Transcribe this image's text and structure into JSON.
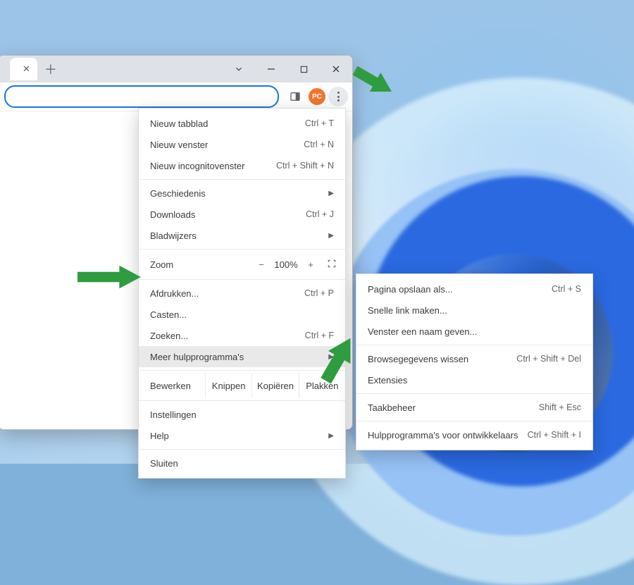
{
  "avatar_initials": "PC",
  "zoom": {
    "label": "Zoom",
    "minus": "−",
    "plus": "+",
    "percent": "100%"
  },
  "main_menu": {
    "new_tab": {
      "label": "Nieuw tabblad",
      "shortcut": "Ctrl + T"
    },
    "new_window": {
      "label": "Nieuw venster",
      "shortcut": "Ctrl + N"
    },
    "new_incognito": {
      "label": "Nieuw incognitovenster",
      "shortcut": "Ctrl + Shift + N"
    },
    "history": {
      "label": "Geschiedenis"
    },
    "downloads": {
      "label": "Downloads",
      "shortcut": "Ctrl + J"
    },
    "bookmarks": {
      "label": "Bladwijzers"
    },
    "print": {
      "label": "Afdrukken...",
      "shortcut": "Ctrl + P"
    },
    "cast": {
      "label": "Casten..."
    },
    "find": {
      "label": "Zoeken...",
      "shortcut": "Ctrl + F"
    },
    "more_tools": {
      "label": "Meer hulpprogramma's"
    },
    "edit": {
      "label": "Bewerken",
      "cut": "Knippen",
      "copy": "Kopiëren",
      "paste": "Plakken"
    },
    "settings": {
      "label": "Instellingen"
    },
    "help": {
      "label": "Help"
    },
    "exit": {
      "label": "Sluiten"
    }
  },
  "sub_menu": {
    "save_page": {
      "label": "Pagina opslaan als...",
      "shortcut": "Ctrl + S"
    },
    "create_shortcut": {
      "label": "Snelle link maken..."
    },
    "name_window": {
      "label": "Venster een naam geven..."
    },
    "clear_data": {
      "label": "Browsegegevens wissen",
      "shortcut": "Ctrl + Shift + Del"
    },
    "extensions": {
      "label": "Extensies"
    },
    "task_manager": {
      "label": "Taakbeheer",
      "shortcut": "Shift + Esc"
    },
    "dev_tools": {
      "label": "Hulpprogramma's voor ontwikkelaars",
      "shortcut": "Ctrl + Shift + I"
    }
  }
}
